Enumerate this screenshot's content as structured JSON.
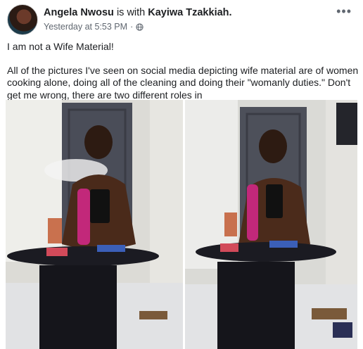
{
  "post": {
    "author": "Angela Nwosu",
    "with_text": "is with",
    "tagged": "Kayiwa Tzakkiah.",
    "timestamp": "Yesterday at 5:53 PM",
    "separator": "·",
    "more_icon": "more-horizontal-icon",
    "privacy_icon": "globe-icon",
    "text_line1": "I am not a Wife Material!",
    "text_para2": "All of the pictures I've seen on social media depicting wife material are of women cooking alone, doing all of the cleaning and doing their \"womanly duties.\" Don't get me wrong, there are two different roles in"
  },
  "colors": {
    "text": "#1c1e21",
    "meta": "#606770",
    "hookah": "#c2287a"
  }
}
